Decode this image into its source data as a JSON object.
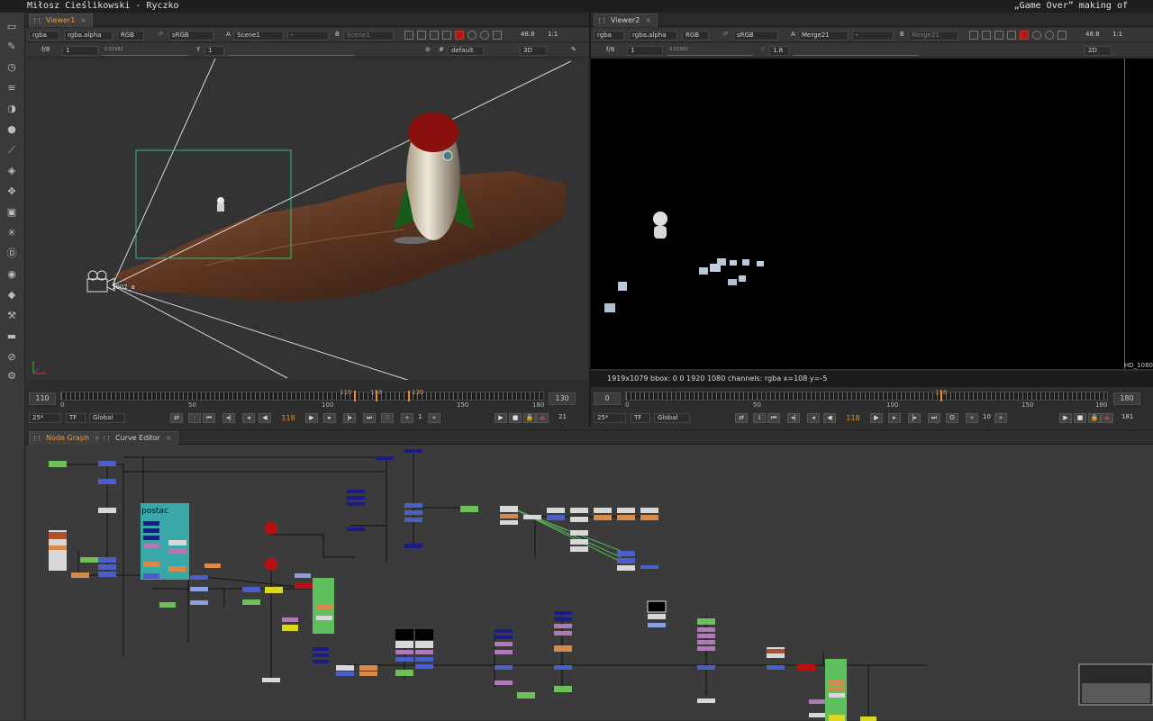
{
  "window": {
    "title_left": "Miłosz Cieślikowski - Ryczko",
    "title_right": "„Game Over” making of"
  },
  "toolbar": {
    "icons": [
      "node-icon",
      "paint-icon",
      "clock-icon",
      "channel-icon",
      "color-icon",
      "sphere-icon",
      "filter-icon",
      "layers-icon",
      "transform-icon",
      "3d-icon",
      "particles-icon",
      "deep-icon",
      "view-icon",
      "metadata-icon",
      "tools-icon",
      "other-icon",
      "furnace-icon",
      "gear-icon"
    ]
  },
  "viewer1": {
    "tab": "Viewer1",
    "channels": "rgba",
    "alpha": "rgba.alpha",
    "colorspace_rgb": "RGB",
    "ip": "IP",
    "lut": "sRGB",
    "a_label": "A",
    "a_input": "Scene1",
    "dash": "-",
    "b_label": "B",
    "b_input": "Scene1",
    "zoom": "48.8",
    "ratio": "1:1",
    "fstop": "f/8",
    "gain": "1",
    "y_label": "Y",
    "gamma": "1",
    "scale_min": "0.01562",
    "scale_vals": [
      "1",
      "16",
      "64"
    ],
    "gamma_vals": [
      "0",
      "0.1",
      "0.5",
      "1",
      "2",
      "3"
    ],
    "camera_mode": "default",
    "view_mode": "3D",
    "camera_label": "1002_a",
    "timeline": {
      "in": "110",
      "out": "130",
      "start_label": "0",
      "labels": [
        "50",
        "100",
        "150"
      ],
      "end_label": "180",
      "marks": [
        "110",
        "118",
        "130"
      ]
    },
    "fps": "25*",
    "tf": "TF",
    "scope": "Global",
    "frame": "118",
    "step": "1",
    "end_frame": "21"
  },
  "viewer2": {
    "tab": "Viewer2",
    "channels": "rgba",
    "alpha": "rgba.alpha",
    "colorspace_rgb": "RGB",
    "ip": "IP",
    "lut": "sRGB",
    "a_label": "A",
    "a_input": "Merge21",
    "dash": "-",
    "b_label": "B",
    "b_input": "Merge21",
    "zoom": "48.8",
    "ratio": "1:1",
    "fstop": "f/8",
    "gain": "1",
    "y_label": "Y",
    "gamma": "1.8",
    "scale_min": "0.01562",
    "view_mode": "2D",
    "format_label": "HD_1080",
    "info": "1919x1079  bbox: 0 0 1920 1080 channels: rgba  x=108 y=-5",
    "timeline": {
      "in": "0",
      "out": "180",
      "start_label": "0",
      "labels": [
        "50",
        "100",
        "150"
      ],
      "end_label": "180",
      "marks": [
        "118"
      ]
    },
    "fps": "25*",
    "tf": "TF",
    "scope": "Global",
    "frame": "118",
    "step": "10",
    "end_frame": "181"
  },
  "nodegraph": {
    "tabs": [
      "Node Graph",
      "Curve Editor"
    ],
    "backdrop_label": "postac",
    "colors": {
      "green": "#6fbf5a",
      "blue": "#4a5fc8",
      "navy": "#1a1a8a",
      "orange": "#d88a4a",
      "yellow": "#d8d820",
      "red": "#b81010",
      "white": "#d8d8d8",
      "purple": "#b07ab8",
      "teal": "#3aa8a8"
    }
  }
}
